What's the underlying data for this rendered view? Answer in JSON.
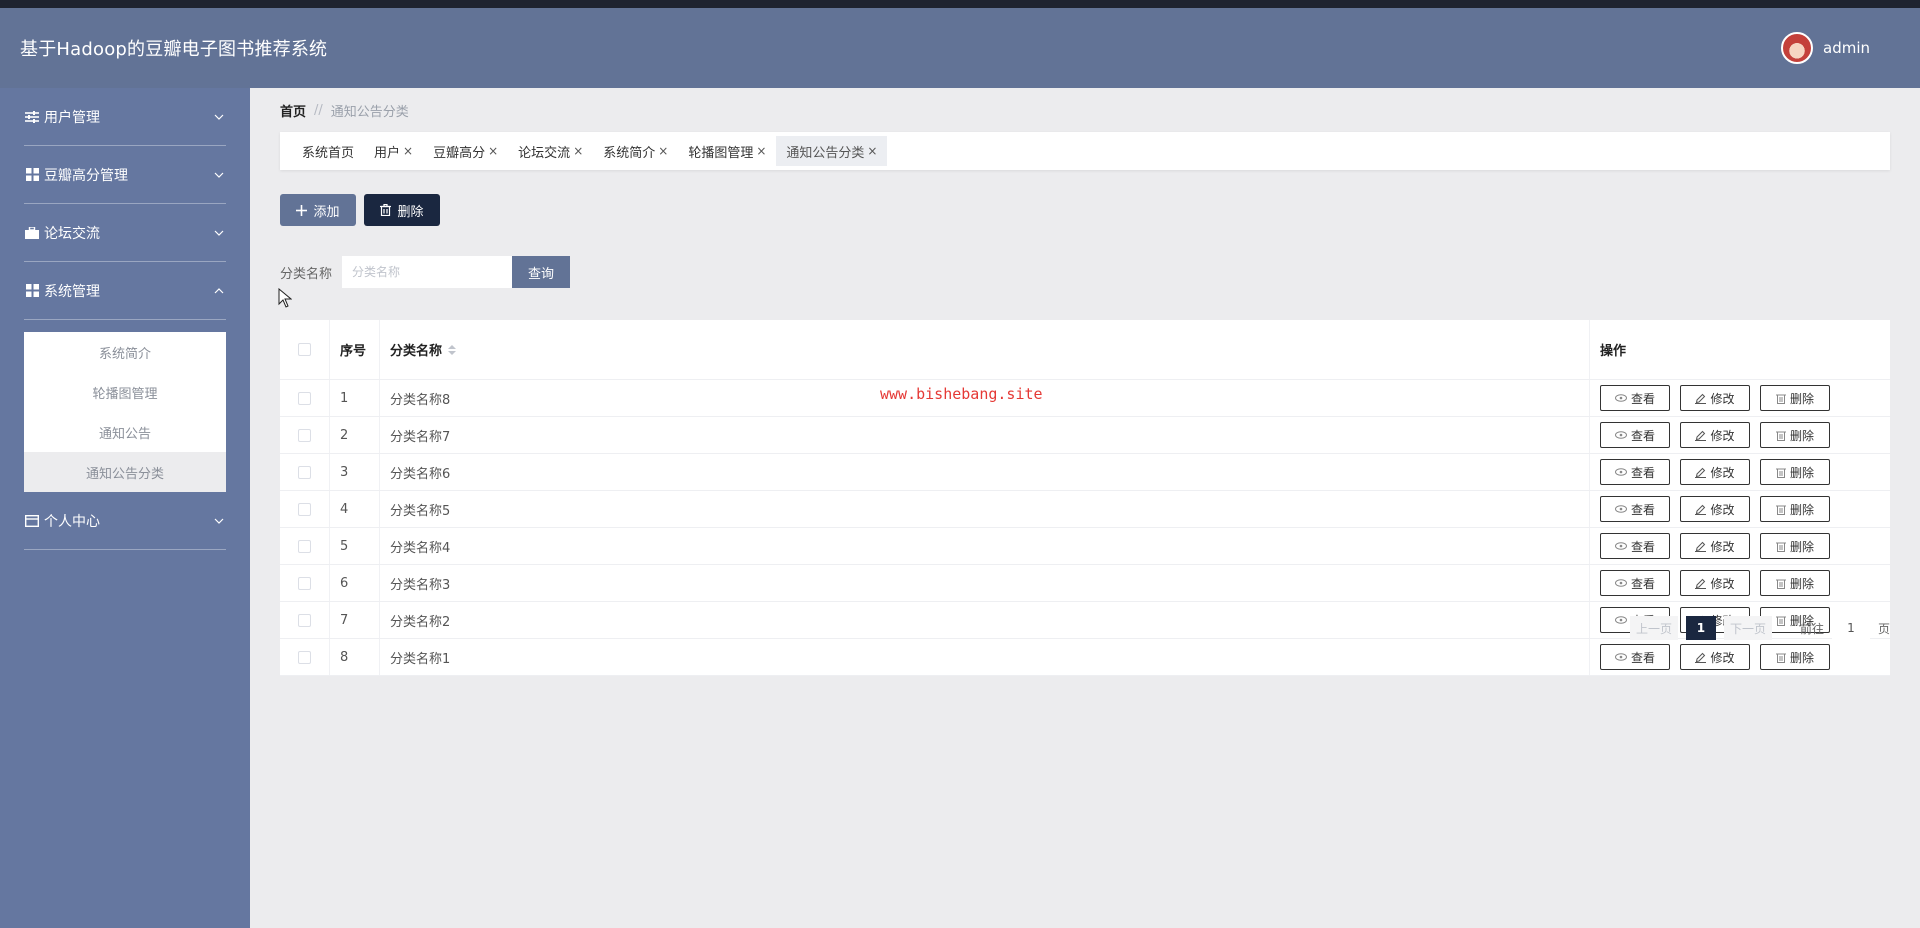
{
  "app": {
    "title": "基于Hadoop的豆瓣电子图书推荐系统"
  },
  "user": {
    "name": "admin"
  },
  "sidebar": {
    "groups": [
      {
        "label": "用户管理",
        "icon": "sliders-icon",
        "expanded": false
      },
      {
        "label": "豆瓣高分管理",
        "icon": "grid-icon",
        "expanded": false
      },
      {
        "label": "论坛交流",
        "icon": "briefcase-icon",
        "expanded": false
      },
      {
        "label": "系统管理",
        "icon": "grid-icon",
        "expanded": true,
        "items": [
          {
            "label": "系统简介"
          },
          {
            "label": "轮播图管理"
          },
          {
            "label": "通知公告"
          },
          {
            "label": "通知公告分类",
            "active": true
          }
        ]
      },
      {
        "label": "个人中心",
        "icon": "card-icon",
        "expanded": false
      }
    ]
  },
  "breadcrumb": {
    "home": "首页",
    "separator": "//",
    "current": "通知公告分类"
  },
  "tabs": [
    {
      "label": "系统首页",
      "closable": false
    },
    {
      "label": "用户",
      "closable": true
    },
    {
      "label": "豆瓣高分",
      "closable": true
    },
    {
      "label": "论坛交流",
      "closable": true
    },
    {
      "label": "系统简介",
      "closable": true
    },
    {
      "label": "轮播图管理",
      "closable": true
    },
    {
      "label": "通知公告分类",
      "closable": true,
      "active": true
    }
  ],
  "tab_close_glyph": "×",
  "toolbar": {
    "add_label": "添加",
    "delete_label": "删除"
  },
  "search": {
    "label": "分类名称",
    "placeholder": "分类名称",
    "value": "",
    "query_label": "查询"
  },
  "table": {
    "headers": {
      "index": "序号",
      "name": "分类名称",
      "ops": "操作"
    },
    "rows": [
      {
        "index": "1",
        "name": "分类名称8"
      },
      {
        "index": "2",
        "name": "分类名称7"
      },
      {
        "index": "3",
        "name": "分类名称6"
      },
      {
        "index": "4",
        "name": "分类名称5"
      },
      {
        "index": "5",
        "name": "分类名称4"
      },
      {
        "index": "6",
        "name": "分类名称3"
      },
      {
        "index": "7",
        "name": "分类名称2"
      },
      {
        "index": "8",
        "name": "分类名称1"
      }
    ],
    "ops": {
      "view": "查看",
      "edit": "修改",
      "delete": "删除"
    }
  },
  "watermark": "www.bishebang.site",
  "pagination": {
    "prev": "上一页",
    "current": "1",
    "next": "下一页",
    "goto": "前往",
    "goto_value": "1",
    "unit": "页"
  },
  "colors": {
    "header": "#627396",
    "sidebar": "#6577a0",
    "dark_button": "#1a2740",
    "watermark": "#e53935"
  }
}
